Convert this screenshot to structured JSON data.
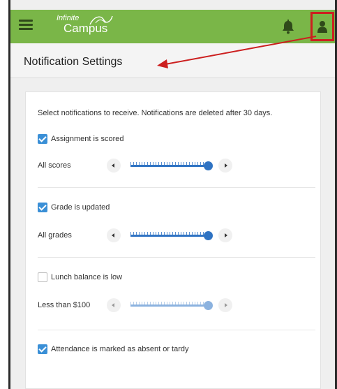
{
  "app": {
    "logo_top": "Infinite",
    "logo_bottom": "Campus"
  },
  "icons": {
    "menu": "hamburger-menu-icon",
    "bell": "bell-icon",
    "user": "user-icon"
  },
  "colors": {
    "topbar": "#7ab648",
    "accent": "#2f73c3",
    "checkbox": "#3a8fd6",
    "highlight": "#cc1f1f"
  },
  "page": {
    "title": "Notification Settings"
  },
  "settings": {
    "intro": "Select notifications to receive. Notifications are deleted after 30 days.",
    "items": [
      {
        "label": "Assignment is scored",
        "checked": true,
        "level_label": "All scores",
        "level": 1.0,
        "enabled": true
      },
      {
        "label": "Grade is updated",
        "checked": true,
        "level_label": "All grades",
        "level": 1.0,
        "enabled": true
      },
      {
        "label": "Lunch balance is low",
        "checked": false,
        "level_label": "Less than $100",
        "level": 1.0,
        "enabled": false
      },
      {
        "label": "Attendance is marked as absent or tardy",
        "checked": true
      }
    ]
  }
}
